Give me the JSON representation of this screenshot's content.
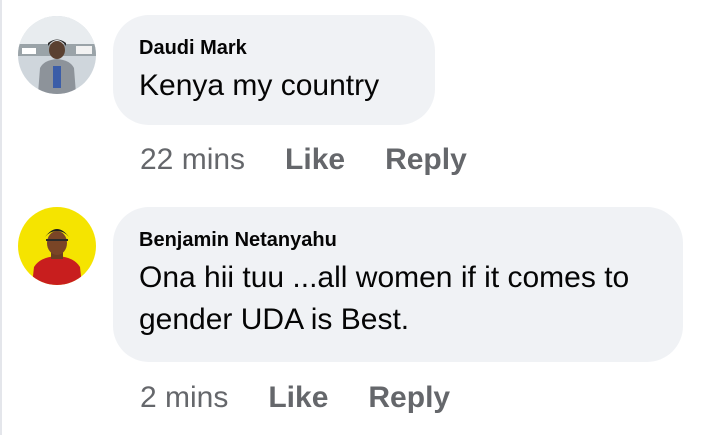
{
  "comments": [
    {
      "author": "Daudi Mark",
      "text": "Kenya my country",
      "time": "22 mins",
      "like_label": "Like",
      "reply_label": "Reply"
    },
    {
      "author": "Benjamin Netanyahu",
      "text": "Ona hii tuu ...all women if it comes to gender UDA is Best.",
      "time": "2 mins",
      "like_label": "Like",
      "reply_label": "Reply"
    }
  ],
  "colors": {
    "bubble_background": "#f0f2f5",
    "meta_text": "#65676b",
    "primary_text": "#050505",
    "avatar_2_background": "#f5e400"
  }
}
